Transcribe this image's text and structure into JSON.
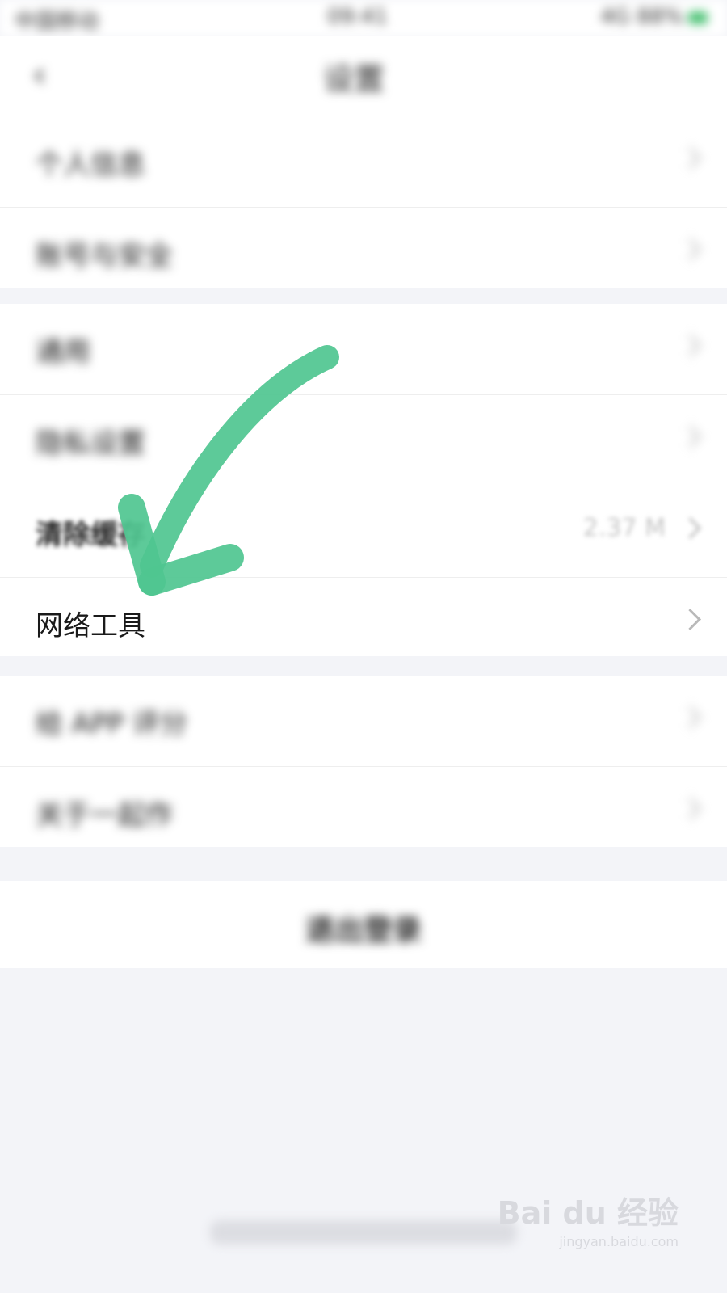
{
  "status_bar": {
    "left": "中国移动",
    "time": "09:41",
    "right": "4G 88%"
  },
  "nav": {
    "back_icon": "chevron-left-icon",
    "title": "设置"
  },
  "groups": [
    {
      "rows": [
        {
          "label": "个人信息"
        },
        {
          "label": "账号与安全"
        }
      ]
    },
    {
      "rows": [
        {
          "label": "通用"
        },
        {
          "label": "隐私设置"
        },
        {
          "label": "清除缓存",
          "value": "2.37 M"
        },
        {
          "label": "网络工具"
        }
      ]
    },
    {
      "rows": [
        {
          "label": "给 APP 评分"
        },
        {
          "label": "关于一起作"
        }
      ]
    }
  ],
  "logout": {
    "label": "退出登录"
  },
  "watermark": {
    "main": "Bai du 经验",
    "sub": "jingyan.baidu.com"
  },
  "colors": {
    "arrow": "#4fc690",
    "background": "#f3f4f8"
  }
}
